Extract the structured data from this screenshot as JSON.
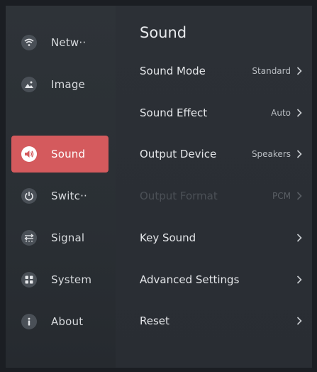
{
  "sidebar": {
    "items": [
      {
        "label": "Netw··",
        "icon": "wifi-icon",
        "active": false
      },
      {
        "label": "Image",
        "icon": "image-icon",
        "active": false
      },
      {
        "label": "Sound",
        "icon": "speaker-icon",
        "active": true
      },
      {
        "label": "Switc··",
        "icon": "power-icon",
        "active": false
      },
      {
        "label": "Signal",
        "icon": "signal-icon",
        "active": false
      },
      {
        "label": "System",
        "icon": "grid-icon",
        "active": false
      },
      {
        "label": "About",
        "icon": "info-icon",
        "active": false
      }
    ]
  },
  "main": {
    "title": "Sound",
    "settings": [
      {
        "label": "Sound Mode",
        "value": "Standard",
        "enabled": true
      },
      {
        "label": "Sound Effect",
        "value": "Auto",
        "enabled": true
      },
      {
        "label": "Output Device",
        "value": "Speakers",
        "enabled": true
      },
      {
        "label": "Output Format",
        "value": "PCM",
        "enabled": false
      },
      {
        "label": "Key Sound",
        "value": "",
        "enabled": true
      },
      {
        "label": "Advanced Settings",
        "value": "",
        "enabled": true
      },
      {
        "label": "Reset",
        "value": "",
        "enabled": true
      }
    ]
  },
  "colors": {
    "accent": "#d45a5d",
    "background": "#262a30",
    "sidebar": "#2e3338",
    "disabled_text": "#4b5056"
  }
}
